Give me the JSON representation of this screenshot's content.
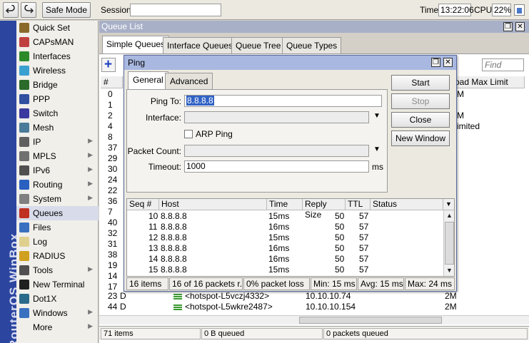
{
  "toolbar": {
    "safe_mode": "Safe Mode",
    "session_label": "Session:",
    "time_label": "Time:",
    "time_value": "13:22:06",
    "cpu_label": "CPU:",
    "cpu_value": "22%"
  },
  "brand": "RouterOS WinBox",
  "menu": [
    {
      "label": "Quick Set",
      "icon": "quick-set-icon",
      "arrow": false
    },
    {
      "label": "CAPsMAN",
      "icon": "capsman-icon",
      "arrow": false
    },
    {
      "label": "Interfaces",
      "icon": "interfaces-icon",
      "arrow": false
    },
    {
      "label": "Wireless",
      "icon": "wireless-icon",
      "arrow": false
    },
    {
      "label": "Bridge",
      "icon": "bridge-icon",
      "arrow": false
    },
    {
      "label": "PPP",
      "icon": "ppp-icon",
      "arrow": false
    },
    {
      "label": "Switch",
      "icon": "switch-icon",
      "arrow": false
    },
    {
      "label": "Mesh",
      "icon": "mesh-icon",
      "arrow": false
    },
    {
      "label": "IP",
      "icon": "ip-icon",
      "arrow": true
    },
    {
      "label": "MPLS",
      "icon": "mpls-icon",
      "arrow": true
    },
    {
      "label": "IPv6",
      "icon": "ipv6-icon",
      "arrow": true
    },
    {
      "label": "Routing",
      "icon": "routing-icon",
      "arrow": true
    },
    {
      "label": "System",
      "icon": "system-icon",
      "arrow": true
    },
    {
      "label": "Queues",
      "icon": "queues-icon",
      "arrow": false
    },
    {
      "label": "Files",
      "icon": "files-icon",
      "arrow": false
    },
    {
      "label": "Log",
      "icon": "log-icon",
      "arrow": false
    },
    {
      "label": "RADIUS",
      "icon": "radius-icon",
      "arrow": false
    },
    {
      "label": "Tools",
      "icon": "tools-icon",
      "arrow": true
    },
    {
      "label": "New Terminal",
      "icon": "terminal-icon",
      "arrow": false
    },
    {
      "label": "Dot1X",
      "icon": "dot1x-icon",
      "arrow": false
    },
    {
      "label": "Windows",
      "icon": "windows-icon",
      "arrow": true
    },
    {
      "label": "More",
      "icon": "",
      "arrow": true
    }
  ],
  "queue_list": {
    "title": "Queue List",
    "tabs": [
      "Simple Queues",
      "Interface Queues",
      "Queue Tree",
      "Queue Types"
    ],
    "find_placeholder": "Find",
    "col_num": "#",
    "col_max_limit": "oad Max Limit",
    "row_nums": [
      "0",
      "1",
      "2",
      "4",
      "8",
      "37",
      "29",
      "30",
      "24",
      "22",
      "36",
      "7",
      "40",
      "32",
      "31",
      "38",
      "19",
      "14",
      "17"
    ],
    "limit_values": [
      "M",
      "",
      "M",
      "imited"
    ],
    "bottom_rows": [
      {
        "num": "23",
        "flag": "D",
        "name": "<hotspot-L5vczj4332>",
        "target": "10.10.10.74",
        "limit": "2M"
      },
      {
        "num": "44",
        "flag": "D",
        "name": "<hotspot-L5wkre2487>",
        "target": "10.10.10.154",
        "limit": "2M"
      }
    ],
    "status": {
      "items": "71 items",
      "bytes": "0 B queued",
      "packets": "0 packets queued"
    }
  },
  "ping": {
    "title": "Ping",
    "tabs": [
      "General",
      "Advanced"
    ],
    "ping_to_label": "Ping To:",
    "ping_to_value": "8.8.8.8",
    "interface_label": "Interface:",
    "arp_ping_label": "ARP Ping",
    "packet_count_label": "Packet Count:",
    "timeout_label": "Timeout:",
    "timeout_value": "1000",
    "timeout_unit": "ms",
    "buttons": {
      "start": "Start",
      "stop": "Stop",
      "close": "Close",
      "new_window": "New Window"
    },
    "columns": {
      "seq": "Seq #",
      "host": "Host",
      "time": "Time",
      "reply_size": "Reply Size",
      "ttl": "TTL",
      "status": "Status"
    },
    "results": [
      {
        "seq": "10",
        "host": "8.8.8.8",
        "time": "15ms",
        "size": "50",
        "ttl": "57"
      },
      {
        "seq": "11",
        "host": "8.8.8.8",
        "time": "16ms",
        "size": "50",
        "ttl": "57"
      },
      {
        "seq": "12",
        "host": "8.8.8.8",
        "time": "15ms",
        "size": "50",
        "ttl": "57"
      },
      {
        "seq": "13",
        "host": "8.8.8.8",
        "time": "16ms",
        "size": "50",
        "ttl": "57"
      },
      {
        "seq": "14",
        "host": "8.8.8.8",
        "time": "16ms",
        "size": "50",
        "ttl": "57"
      },
      {
        "seq": "15",
        "host": "8.8.8.8",
        "time": "15ms",
        "size": "50",
        "ttl": "57"
      }
    ],
    "status": {
      "items": "16 items",
      "packets": "16 of 16 packets r...",
      "loss": "0% packet loss",
      "min": "Min: 15 ms",
      "avg": "Avg: 15 ms",
      "max": "Max: 24 ms"
    }
  }
}
